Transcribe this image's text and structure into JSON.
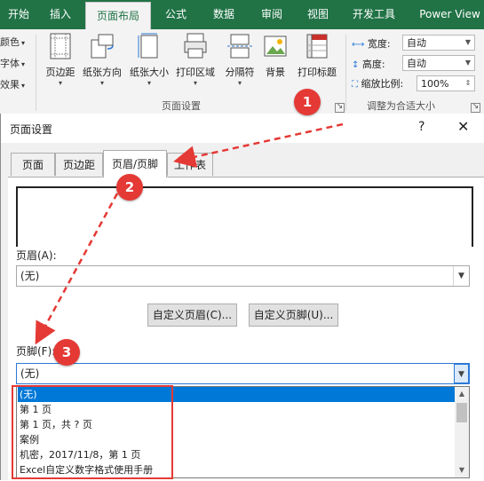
{
  "ribbon": {
    "tabs": [
      {
        "label": "开始"
      },
      {
        "label": "插入"
      },
      {
        "label": "页面布局",
        "active": true
      },
      {
        "label": "公式"
      },
      {
        "label": "数据"
      },
      {
        "label": "审阅"
      },
      {
        "label": "视图"
      },
      {
        "label": "开发工具"
      },
      {
        "label": "Power View"
      }
    ],
    "theme_items": [
      "颜色",
      "字体",
      "效果"
    ],
    "page_setup_buttons": [
      {
        "label": "页边距",
        "icon": "margins-icon"
      },
      {
        "label": "纸张方向",
        "icon": "orientation-icon"
      },
      {
        "label": "纸张大小",
        "icon": "paper-size-icon"
      },
      {
        "label": "打印区域",
        "icon": "print-area-icon"
      },
      {
        "label": "分隔符",
        "icon": "breaks-icon"
      },
      {
        "label": "背景",
        "icon": "background-icon"
      },
      {
        "label": "打印标题",
        "icon": "print-titles-icon"
      }
    ],
    "page_setup_group_label": "页面设置",
    "scale_group": {
      "width_label": "宽度:",
      "width_value": "自动",
      "height_label": "高度:",
      "height_value": "自动",
      "scale_label": "缩放比例:",
      "scale_value": "100%",
      "group_label": "调整为合适大小"
    }
  },
  "dialog": {
    "title": "页面设置",
    "help": "?",
    "close": "✕",
    "tabs": [
      {
        "label": "页面"
      },
      {
        "label": "页边距"
      },
      {
        "label": "页眉/页脚",
        "active": true
      },
      {
        "label": "工作表"
      }
    ],
    "header_label": "页眉(A):",
    "header_value": "(无)",
    "custom_header_button": "自定义页眉(C)...",
    "custom_footer_button": "自定义页脚(U)...",
    "footer_label": "页脚(F):",
    "footer_value": "(无)",
    "footer_options": [
      "(无)",
      "第 1 页",
      "第 1 页，共 ? 页",
      "案例",
      " 机密，2017/11/8，第 1 页",
      "Excel自定义数字格式使用手册"
    ]
  },
  "annotations": {
    "markers": [
      "1",
      "2",
      "3"
    ],
    "accent_color": "#e53935"
  },
  "colors": {
    "excel_green": "#217346",
    "selection_blue": "#0078d7"
  }
}
